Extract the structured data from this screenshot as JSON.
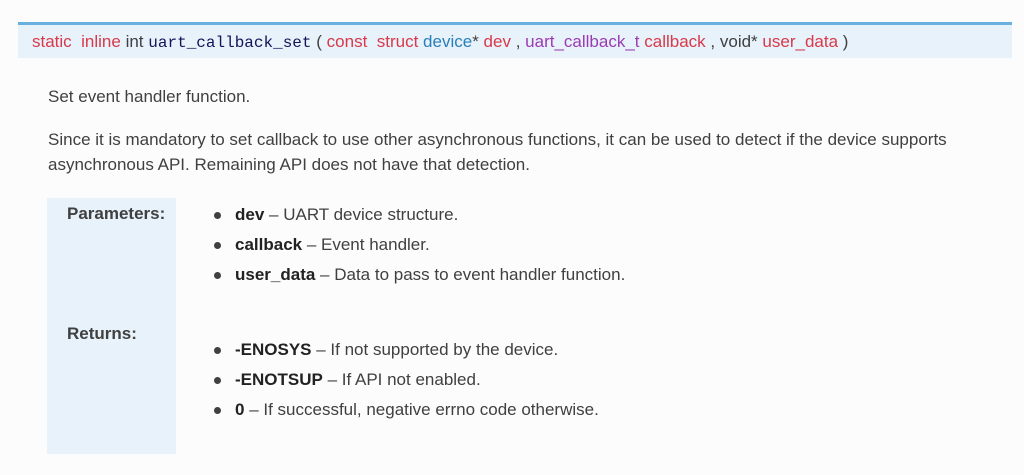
{
  "signature": {
    "static": "static",
    "inline": "inline",
    "return_type": "int",
    "function_name": "uart_callback_set",
    "open_paren": "(",
    "p1_const": "const",
    "p1_struct": "struct",
    "p1_type": "device",
    "p1_star": "*",
    "p1_name": "dev",
    "comma1": ",",
    "p2_type": "uart_callback_t",
    "p2_name": "callback",
    "comma2": ",",
    "p3_type": "void*",
    "p3_name": "user_data",
    "close_paren": ")"
  },
  "description": {
    "summary": "Set event handler function.",
    "details": "Since it is mandatory to set callback to use other asynchronous functions, it can be used to detect if the device supports asynchronous API. Remaining API does not have that detection."
  },
  "parameters": {
    "heading": "Parameters:",
    "items": [
      {
        "name": "dev",
        "desc": " – UART device structure."
      },
      {
        "name": "callback",
        "desc": " – Event handler."
      },
      {
        "name": "user_data",
        "desc": " – Data to pass to event handler function."
      }
    ]
  },
  "returns": {
    "heading": "Returns:",
    "items": [
      {
        "name": "-ENOSYS",
        "desc": " – If not supported by the device."
      },
      {
        "name": "-ENOTSUP",
        "desc": " – If API not enabled."
      },
      {
        "name": "0",
        "desc": " – If successful, negative errno code otherwise."
      }
    ]
  },
  "colors": {
    "signature_bg": "#e7f2fa",
    "signature_border": "#6ab0de",
    "keyword": "#d9394a",
    "type_link": "#2980b9",
    "type_link2": "#9b3bb3",
    "function_name": "#14145a"
  }
}
